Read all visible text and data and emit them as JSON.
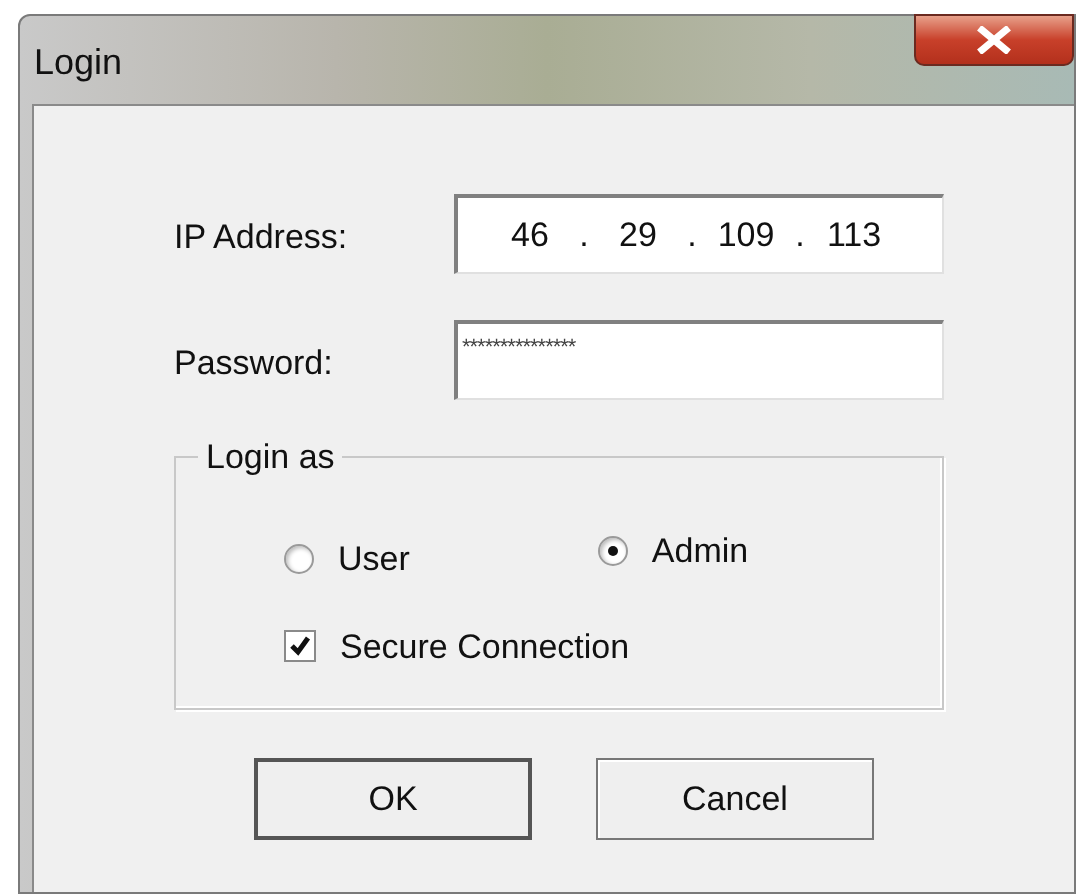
{
  "window": {
    "title": "Login"
  },
  "ip_address": {
    "label": "IP Address:",
    "octets": [
      "46",
      "29",
      "109",
      "113"
    ],
    "separator": "."
  },
  "password": {
    "label": "Password:",
    "value": "***************"
  },
  "login_as": {
    "legend": "Login as",
    "options": [
      {
        "label": "User",
        "selected": false
      },
      {
        "label": "Admin",
        "selected": true
      }
    ]
  },
  "secure_connection": {
    "label": "Secure Connection",
    "checked": true
  },
  "buttons": [
    "OK",
    "Cancel"
  ]
}
